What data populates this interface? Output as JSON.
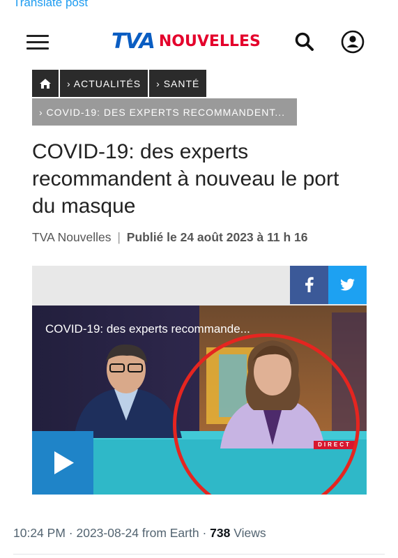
{
  "tweet": {
    "translate_link": "Translate post",
    "time": "10:24 PM",
    "date": "2023-08-24",
    "source": "from Earth",
    "views_count": "738",
    "views_label": "Views"
  },
  "site_header": {
    "logo_tva": "TVA",
    "logo_nouvelles": "NOUVELLES",
    "menu_icon": "hamburger-menu-icon",
    "search_icon": "search-icon",
    "account_icon": "user-account-icon"
  },
  "breadcrumb": {
    "home_icon": "home-icon",
    "items": [
      "› ACTUALITÉS",
      "› SANTÉ"
    ],
    "current": "› COVID-19: DES EXPERTS RECOMMANDENT..."
  },
  "article": {
    "title": "COVID-19: des experts recommandent à nouveau le port du masque",
    "author": "TVA Nouvelles",
    "separator": "|",
    "published": "Publié le 24 août 2023 à 11 h 16"
  },
  "video": {
    "title": "COVID-19: des experts recommande...",
    "live_badge": "DIRECT",
    "play_icon": "play-icon"
  },
  "share": {
    "facebook_icon": "facebook-icon",
    "twitter_icon": "twitter-icon"
  },
  "colors": {
    "tva_blue": "#0a5dc2",
    "nouvelles_red": "#e4002b",
    "facebook": "#3b5998",
    "twitter": "#1da1f2",
    "play_blue": "#1f84c8",
    "annotation_circle": "#e52520",
    "link_blue": "#1d9bf0"
  }
}
